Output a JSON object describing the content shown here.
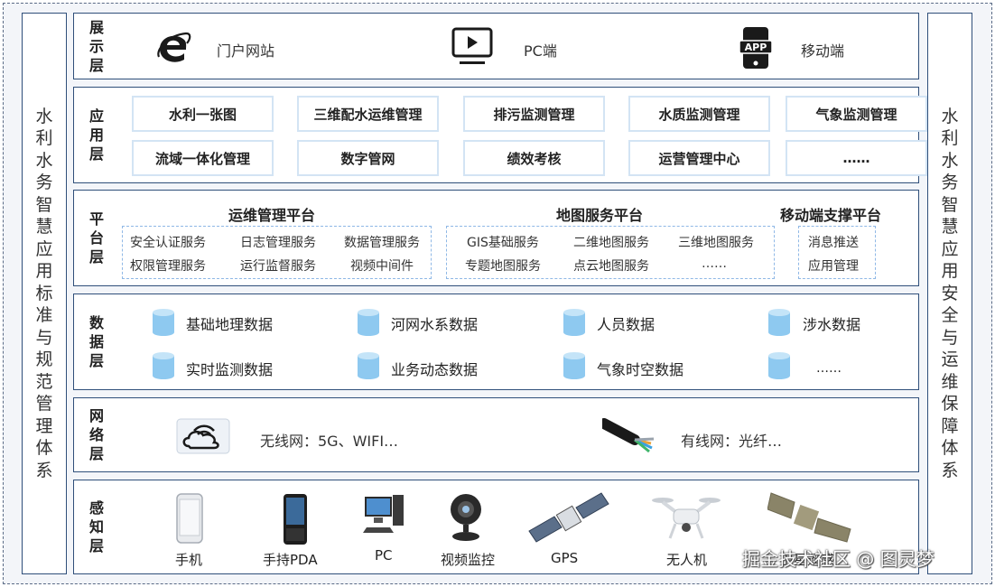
{
  "left_panel": {
    "chars": [
      "水",
      "利",
      "水",
      "务",
      "智",
      "慧",
      "应",
      "用",
      "标",
      "准",
      "与",
      "规",
      "范",
      "管",
      "理",
      "体",
      "系"
    ]
  },
  "right_panel": {
    "chars": [
      "水",
      "利",
      "水",
      "务",
      "智",
      "慧",
      "应",
      "用",
      "安",
      "全",
      "与",
      "运",
      "维",
      "保",
      "障",
      "体",
      "系"
    ]
  },
  "layers": {
    "display": {
      "label": [
        "展",
        "示",
        "层"
      ],
      "items": [
        {
          "icon": "internet-explorer-icon",
          "label": "门户网站"
        },
        {
          "icon": "monitor-icon",
          "label": "PC端"
        },
        {
          "icon": "app-phone-icon",
          "icon_text": "APP",
          "label": "移动端"
        }
      ]
    },
    "application": {
      "label": [
        "应",
        "用",
        "层"
      ],
      "boxes": [
        "水利一张图",
        "三维配水运维管理",
        "排污监测管理",
        "水质监测管理",
        "气象监测管理",
        "流域一体化管理",
        "数字管网",
        "绩效考核",
        "运营管理中心",
        "……"
      ]
    },
    "platform": {
      "label": [
        "平",
        "台",
        "层"
      ],
      "groups": [
        {
          "title": "运维管理平台",
          "services": [
            "安全认证服务",
            "日志管理服务",
            "数据管理服务",
            "权限管理服务",
            "运行监督服务",
            "视频中间件"
          ]
        },
        {
          "title": "地图服务平台",
          "services": [
            "GIS基础服务",
            "二维地图服务",
            "三维地图服务",
            "专题地图服务",
            "点云地图服务",
            "……"
          ]
        },
        {
          "title": "移动端支撑平台",
          "services": [
            "消息推送",
            "应用管理"
          ]
        }
      ]
    },
    "data": {
      "label": [
        "数",
        "据",
        "层"
      ],
      "items": [
        "基础地理数据",
        "河网水系数据",
        "人员数据",
        "涉水数据",
        "实时监测数据",
        "业务动态数据",
        "气象时空数据",
        "……"
      ]
    },
    "network": {
      "label": [
        "网",
        "络",
        "层"
      ],
      "items": [
        {
          "icon": "wireless-cloud-icon",
          "label": "无线网：5G、WIFI…"
        },
        {
          "icon": "fiber-cable-icon",
          "label": "有线网：光纤…"
        }
      ]
    },
    "perception": {
      "label": [
        "感",
        "知",
        "层"
      ],
      "devices": [
        {
          "icon": "smartphone-icon",
          "label": "手机"
        },
        {
          "icon": "handheld-pda-icon",
          "label": "手持PDA"
        },
        {
          "icon": "desktop-pc-icon",
          "label": "PC"
        },
        {
          "icon": "webcam-icon",
          "label": "视频监控"
        },
        {
          "icon": "gps-satellite-icon",
          "label": "GPS"
        },
        {
          "icon": "drone-icon",
          "label": "无人机"
        },
        {
          "icon": "satellite-icon",
          "label": "卫星遥感"
        }
      ]
    }
  },
  "watermark": "掘金技术社区 @ 图灵梦",
  "colors": {
    "border": "#2f4f7a",
    "box_border": "#d3e4f4",
    "dash": "#8fb8e6",
    "db_fill": "#8ec9f0"
  }
}
